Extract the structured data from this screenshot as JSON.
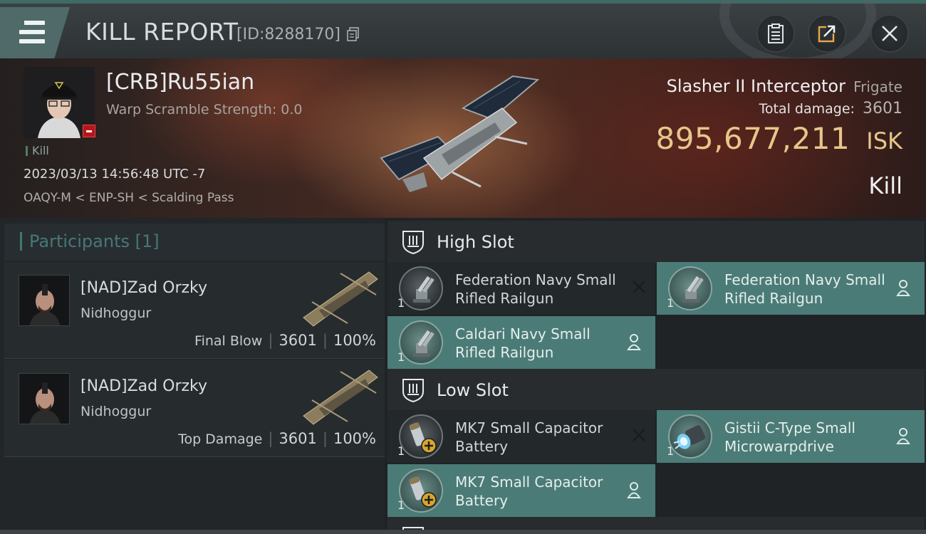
{
  "titlebar": {
    "title": "KILL REPORT",
    "report_id": "[ID:8288170]"
  },
  "victim": {
    "pilot_name": "[CRB]Ru55ian",
    "scramble_text": "Warp Scramble Strength: 0.0",
    "kill_tag": "Kill",
    "datetime": "2023/03/13 14:56:48 UTC -7",
    "location": "OAQY-M < ENP-SH < Scalding Pass",
    "ship_name": "Slasher II Interceptor",
    "ship_class": "Frigate",
    "total_damage_label": "Total damage:",
    "total_damage": "3601",
    "isk_value": "895,677,211",
    "isk_unit": "ISK",
    "result": "Kill"
  },
  "participants": {
    "header": "Participants [1]",
    "rows": [
      {
        "name": "[NAD]Zad Orzky",
        "ship": "Nidhoggur",
        "label": "Final Blow",
        "damage": "3601",
        "percent": "100%"
      },
      {
        "name": "[NAD]Zad Orzky",
        "ship": "Nidhoggur",
        "label": "Top Damage",
        "damage": "3601",
        "percent": "100%"
      }
    ]
  },
  "slots": {
    "high": {
      "title": "High Slot",
      "modules": [
        {
          "name": "Federation Navy Small Rifled Railgun",
          "qty": "1",
          "state": "destroyed"
        },
        {
          "name": "Federation Navy Small Rifled Railgun",
          "qty": "1",
          "state": "dropped"
        },
        {
          "name": "Caldari Navy Small Rifled Railgun",
          "qty": "1",
          "state": "dropped"
        }
      ]
    },
    "low": {
      "title": "Low Slot",
      "modules": [
        {
          "name": "MK7 Small Capacitor Battery",
          "qty": "1",
          "state": "destroyed"
        },
        {
          "name": "Gistii C-Type Small Microwarpdrive",
          "qty": "1",
          "state": "dropped"
        },
        {
          "name": "MK7 Small Capacitor Battery",
          "qty": "1",
          "state": "dropped"
        }
      ]
    }
  },
  "colors": {
    "accent_teal": "#4b7b76",
    "isk_gold": "#e7c68a",
    "kill_badge_red": "#b8141a"
  },
  "icons": [
    "menu-icon",
    "copy-icon",
    "clipboard-icon",
    "share-icon",
    "close-icon",
    "slot-icon",
    "close-x-icon",
    "person-icon"
  ]
}
